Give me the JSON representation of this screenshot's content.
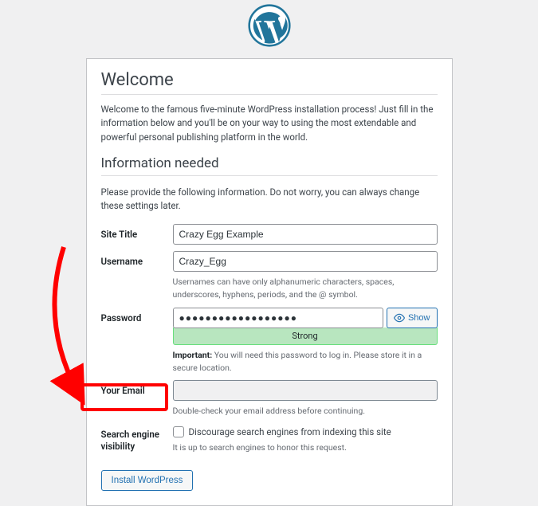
{
  "headings": {
    "welcome": "Welcome",
    "info_needed": "Information needed"
  },
  "intro_text": "Welcome to the famous five-minute WordPress installation process! Just fill in the information below and you'll be on your way to using the most extendable and powerful personal publishing platform in the world.",
  "sub_text": "Please provide the following information. Do not worry, you can always change these settings later.",
  "fields": {
    "site_title": {
      "label": "Site Title",
      "value": "Crazy Egg Example"
    },
    "username": {
      "label": "Username",
      "value": "Crazy_Egg",
      "hint": "Usernames can have only alphanumeric characters, spaces, underscores, hyphens, periods, and the @ symbol."
    },
    "password": {
      "label": "Password",
      "value": "●●●●●●●●●●●●●●●●●●",
      "show_label": "Show",
      "strength": "Strong",
      "hint_strong": "Important:",
      "hint_rest": " You will need this password to log in. Please store it in a secure location."
    },
    "email": {
      "label": "Your Email",
      "value": "",
      "hint": "Double-check your email address before continuing."
    },
    "search": {
      "label": "Search engine visibility",
      "checkbox_label": "Discourage search engines from indexing this site",
      "hint": "It is up to search engines to honor this request."
    }
  },
  "install_button": "Install WordPress"
}
